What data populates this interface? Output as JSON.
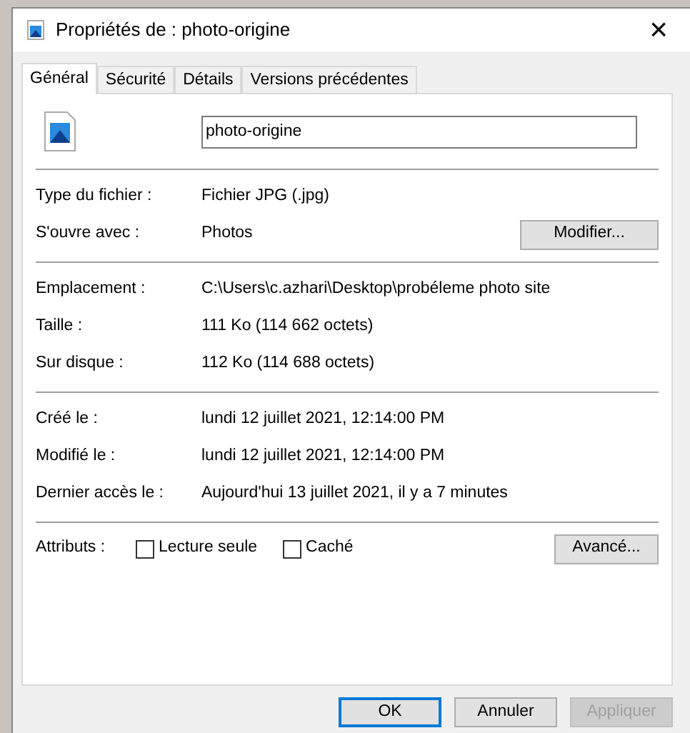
{
  "window": {
    "title": "Propriétés de : photo-origine",
    "close": "×"
  },
  "tabs": [
    {
      "label": "Général",
      "selected": true
    },
    {
      "label": "Sécurité",
      "selected": false
    },
    {
      "label": "Détails",
      "selected": false
    },
    {
      "label": "Versions précédentes",
      "selected": false
    }
  ],
  "file_name": {
    "value": "photo-origine"
  },
  "sections": [
    {
      "rows": [
        {
          "label": "Type du fichier :",
          "value": "Fichier JPG (.jpg)"
        },
        {
          "label": "S'ouvre avec :",
          "value": "Photos",
          "button": "Modifier..."
        }
      ]
    },
    {
      "rows": [
        {
          "label": "Emplacement :",
          "value": "C:\\Users\\c.azhari\\Desktop\\probéleme photo site"
        },
        {
          "label": "Taille :",
          "value": "111 Ko (114 662 octets)"
        },
        {
          "label": "Sur disque :",
          "value": "112 Ko (114 688 octets)"
        }
      ]
    },
    {
      "rows": [
        {
          "label": "Créé le :",
          "value": "lundi 12 juillet 2021, 12:14:00 PM"
        },
        {
          "label": "Modifié le :",
          "value": "lundi 12 juillet 2021, 12:14:00 PM"
        },
        {
          "label": "Dernier accès le :",
          "value": "Aujourd'hui 13 juillet 2021, il y a 7 minutes"
        }
      ]
    }
  ],
  "attributes": {
    "label": "Attributs :",
    "checkboxes": [
      {
        "label": "Lecture seule",
        "checked": false
      },
      {
        "label": "Caché",
        "checked": false
      }
    ],
    "button": "Avancé..."
  },
  "buttons": [
    {
      "label": "OK",
      "default": true,
      "disabled": false
    },
    {
      "label": "Annuler",
      "default": false,
      "disabled": false
    },
    {
      "label": "Appliquer",
      "default": false,
      "disabled": true
    }
  ]
}
